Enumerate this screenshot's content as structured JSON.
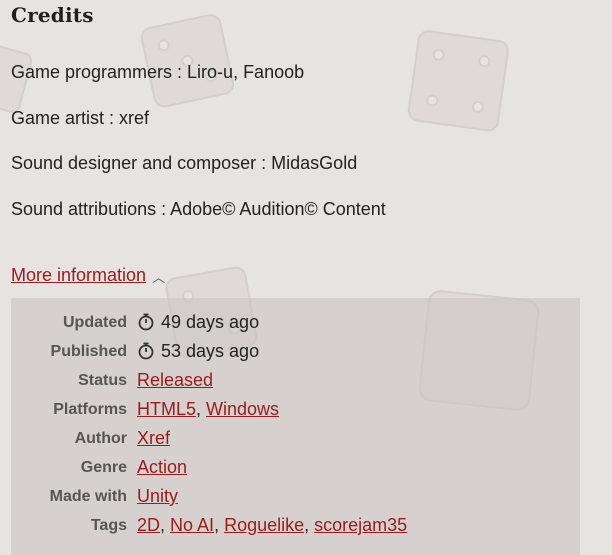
{
  "heading": "Credits",
  "credits": [
    "Game programmers : Liro-u, Fanoob",
    "Game artist : xref",
    "Sound designer and composer : MidasGold",
    "Sound attributions : Adobe© Audition© Content"
  ],
  "more_information": {
    "label": "More information",
    "caret": "^"
  },
  "info": {
    "updated": {
      "label": "Updated",
      "value": "49 days ago",
      "icon": "stopwatch-icon"
    },
    "published": {
      "label": "Published",
      "value": "53 days ago",
      "icon": "stopwatch-icon"
    },
    "status": {
      "label": "Status",
      "value": "Released"
    },
    "platforms": {
      "label": "Platforms",
      "values": [
        "HTML5",
        "Windows"
      ]
    },
    "author": {
      "label": "Author",
      "value": "Xref"
    },
    "genre": {
      "label": "Genre",
      "value": "Action"
    },
    "made_with": {
      "label": "Made with",
      "value": "Unity"
    },
    "tags": {
      "label": "Tags",
      "values": [
        "2D",
        "No AI",
        "Roguelike",
        "scorejam35"
      ]
    }
  },
  "colors": {
    "background": "#e7e3e1",
    "link": "#9a1b1b",
    "panel": "#d4cfcd"
  }
}
